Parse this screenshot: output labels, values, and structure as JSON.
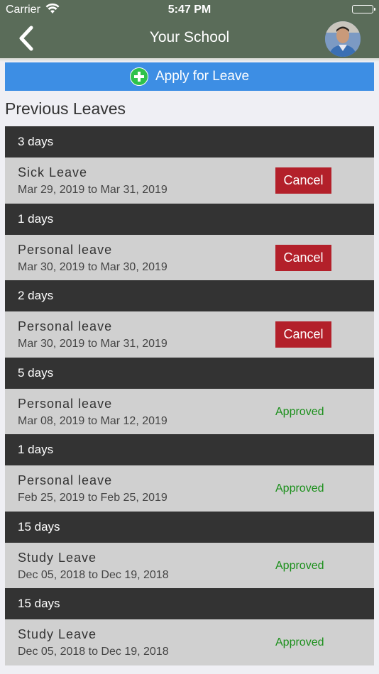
{
  "status_bar": {
    "carrier": "Carrier",
    "time": "5:47 PM"
  },
  "nav": {
    "title": "Your School"
  },
  "apply_button": {
    "label": "Apply for Leave"
  },
  "section_title": "Previous Leaves",
  "leaves": [
    {
      "days": "3 days",
      "type": "Sick Leave",
      "dates": "Mar 29, 2019 to Mar 31, 2019",
      "action": "Cancel",
      "status": ""
    },
    {
      "days": "1 days",
      "type": "Personal leave",
      "dates": "Mar 30, 2019 to Mar 30, 2019",
      "action": "Cancel",
      "status": ""
    },
    {
      "days": "2 days",
      "type": "Personal leave",
      "dates": "Mar 30, 2019 to Mar 31, 2019",
      "action": "Cancel",
      "status": ""
    },
    {
      "days": "5 days",
      "type": "Personal leave",
      "dates": "Mar 08, 2019 to Mar 12, 2019",
      "action": "",
      "status": "Approved"
    },
    {
      "days": "1 days",
      "type": "Personal leave",
      "dates": "Feb 25, 2019 to Feb 25, 2019",
      "action": "",
      "status": "Approved"
    },
    {
      "days": "15 days",
      "type": "Study Leave",
      "dates": "Dec 05, 2018 to Dec 19, 2018",
      "action": "",
      "status": "Approved"
    },
    {
      "days": "15 days",
      "type": "Study Leave",
      "dates": "Dec 05, 2018 to Dec 19, 2018",
      "action": "",
      "status": "Approved"
    }
  ],
  "colors": {
    "nav_background": "#5a6c59",
    "apply_button": "#3d8ee4",
    "cancel_button": "#b3202a",
    "approved_text": "#1a8f1a",
    "days_header": "#333333",
    "row_background": "#d0d0d0"
  },
  "icons": {
    "back": "chevron-left-icon",
    "wifi": "wifi-icon",
    "battery": "battery-icon",
    "apply": "plus-circle-icon",
    "avatar": "user-avatar"
  }
}
